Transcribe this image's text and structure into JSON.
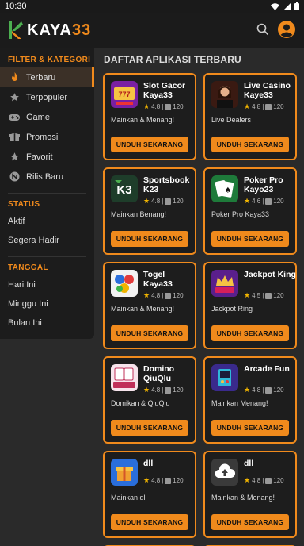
{
  "status": {
    "time": "10:30"
  },
  "app": {
    "logo": "KAYA",
    "logo_accent": "33"
  },
  "sidebar": {
    "filter_heading": "FILTER & KATEGORI",
    "items": [
      {
        "label": "Terbaru",
        "icon": "flame-icon"
      },
      {
        "label": "Terpopuler",
        "icon": "star-icon"
      },
      {
        "label": "Game",
        "icon": "gamepad-icon"
      },
      {
        "label": "Promosi",
        "icon": "gift-icon"
      },
      {
        "label": "Favorit",
        "icon": "star-icon"
      },
      {
        "label": "Rilis Baru",
        "icon": "new-badge-icon"
      }
    ],
    "status_heading": "STATUS",
    "status_items": [
      "Aktif",
      "Segera Hadir"
    ],
    "date_heading": "TANGGAL",
    "date_items": [
      "Hari Ini",
      "Minggu Ini",
      "Bulan Ini"
    ]
  },
  "main": {
    "title": "DAFTAR APLIKASI TERBARU",
    "button_label": "UNDUH SEKARANG",
    "apps": [
      {
        "name": "Slot Gacor Kaya33",
        "rating": "4.8",
        "count": "120",
        "desc": "Mainkan & Menang!"
      },
      {
        "name": "Live Casino Kaye33",
        "rating": "4.8",
        "count": "120",
        "desc": "Live Dealers"
      },
      {
        "name": "Sportsbook K23",
        "rating": "4.8",
        "count": "120",
        "desc": "Mainkan Benang!"
      },
      {
        "name": "Poker Pro Kayo23",
        "rating": "4.6",
        "count": "120",
        "desc": "Poker Pro Kaya33"
      },
      {
        "name": "Togel Kaya33",
        "rating": "4.8",
        "count": "120",
        "desc": "Mainkan & Menang!"
      },
      {
        "name": "Jackpot King",
        "rating": "4.5",
        "count": "120",
        "desc": "Jackpot Ring"
      },
      {
        "name": "Domino QiuQlu",
        "rating": "4.8",
        "count": "120",
        "desc": "Domikan & QiuQlu"
      },
      {
        "name": "Arcade Fun",
        "rating": "4.8",
        "count": "120",
        "desc": "Mainkan Menang!"
      },
      {
        "name": "dll",
        "rating": "4.8",
        "count": "120",
        "desc": "Mainkan dll"
      },
      {
        "name": "dll",
        "rating": "4.8",
        "count": "120",
        "desc": "Mainkan & Menang!"
      }
    ]
  },
  "colors": {
    "accent": "#f08a1c",
    "background": "#2a2a2a",
    "card": "#1d1d1d"
  }
}
